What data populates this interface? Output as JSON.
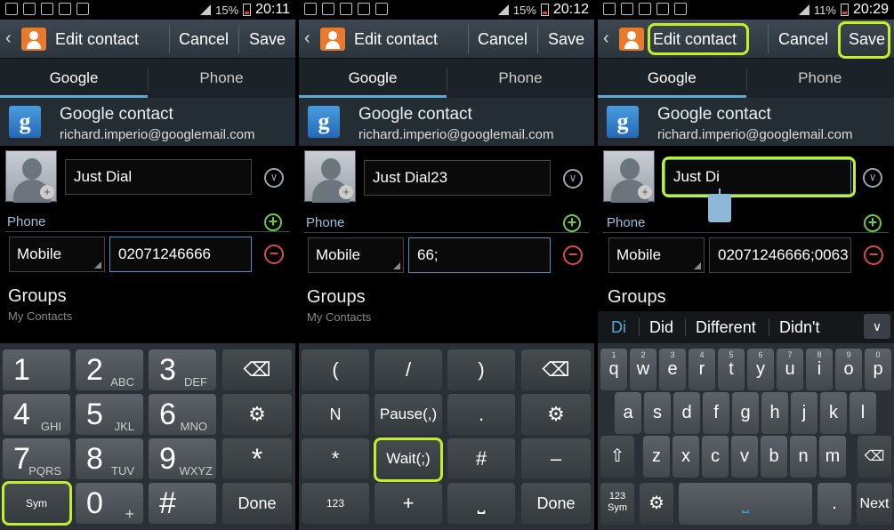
{
  "screens": [
    {
      "status": {
        "battery": "15%",
        "time": "20:11"
      },
      "header": {
        "title": "Edit contact",
        "cancel": "Cancel",
        "save": "Save"
      },
      "tabs": [
        "Google",
        "Phone"
      ],
      "account": {
        "type": "Google contact",
        "email": "richard.imperio@googlemail.com"
      },
      "name_value": "Just Dial",
      "phone_label": "Phone",
      "phone_type": "Mobile",
      "phone_value": "02071246666",
      "groups": "Groups",
      "groups_sub": "My Contacts",
      "keypad": [
        [
          "1",
          "",
          "2",
          "ABC",
          "3",
          "DEF"
        ],
        [
          "4",
          "GHI",
          "5",
          "JKL",
          "6",
          "MNO"
        ],
        [
          "7",
          "PQRS",
          "8",
          "TUV",
          "9",
          "WXYZ"
        ]
      ],
      "keys": {
        "star": "*",
        "sym": "Sym",
        "zero": "0",
        "plus": "+",
        "hash": "#",
        "done": "Done"
      }
    },
    {
      "status": {
        "battery": "15%",
        "time": "20:12"
      },
      "header": {
        "title": "Edit contact",
        "cancel": "Cancel",
        "save": "Save"
      },
      "tabs": [
        "Google",
        "Phone"
      ],
      "account": {
        "type": "Google contact",
        "email": "richard.imperio@googlemail.com"
      },
      "name_value": "Just Dial23",
      "phone_label": "Phone",
      "phone_type": "Mobile",
      "phone_value": "66;",
      "groups": "Groups",
      "groups_sub": "My Contacts",
      "keys": {
        "r1": [
          "(",
          "/",
          ")"
        ],
        "r2": [
          "N",
          "Pause(,)",
          "."
        ],
        "r3": [
          "*",
          "Wait(;)",
          "#",
          "–"
        ],
        "r4": [
          "123",
          "+",
          "Done"
        ]
      }
    },
    {
      "status": {
        "battery": "11%",
        "time": "20:29"
      },
      "header": {
        "title": "Edit contact",
        "cancel": "Cancel",
        "save": "Save"
      },
      "tabs": [
        "Google",
        "Phone"
      ],
      "account": {
        "type": "Google contact",
        "email": "richard.imperio@googlemail.com"
      },
      "name_value": "Just Di",
      "phone_label": "Phone",
      "phone_type": "Mobile",
      "phone_value": "02071246666;0063",
      "groups": "Groups",
      "suggestions": [
        "Di",
        "Did",
        "Different",
        "Didn't"
      ],
      "qwerty": {
        "row1": [
          [
            "q",
            "1"
          ],
          [
            "w",
            "2"
          ],
          [
            "e",
            "3"
          ],
          [
            "r",
            "4"
          ],
          [
            "t",
            "5"
          ],
          [
            "y",
            "6"
          ],
          [
            "u",
            "7"
          ],
          [
            "i",
            "8"
          ],
          [
            "o",
            "9"
          ],
          [
            "p",
            "0"
          ]
        ],
        "row2": [
          "a",
          "s",
          "d",
          "f",
          "g",
          "h",
          "j",
          "k",
          "l"
        ],
        "row3": [
          "z",
          "x",
          "c",
          "v",
          "b",
          "n",
          "m"
        ],
        "sym_top": "123",
        "sym_bottom": "Sym",
        "period": ".",
        "next": "Next"
      }
    }
  ]
}
